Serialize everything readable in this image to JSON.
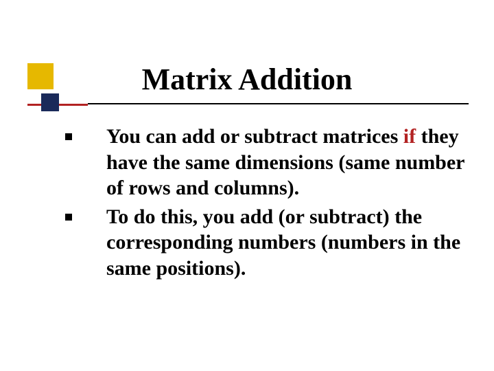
{
  "slide": {
    "title": "Matrix Addition",
    "bullets": [
      {
        "prefix": "You can add or subtract matrices ",
        "highlight": "if",
        "suffix": " they have the same dimensions (same number of rows and columns)."
      },
      {
        "prefix": "To do this, you add (or subtract) the corresponding numbers (numbers in the same positions).",
        "highlight": "",
        "suffix": ""
      }
    ]
  }
}
